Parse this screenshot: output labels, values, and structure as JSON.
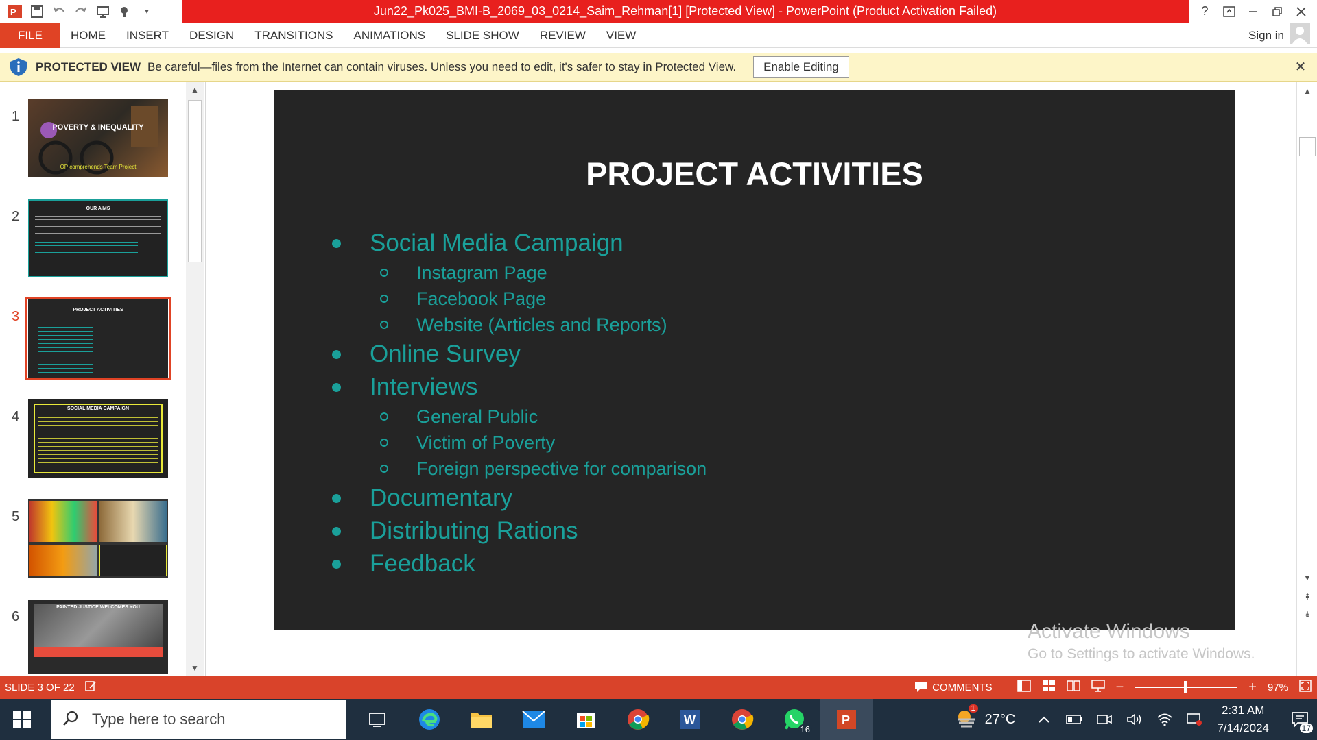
{
  "window": {
    "title": "Jun22_Pk025_BMI-B_2069_03_0214_Saim_Rehman[1] [Protected View] -  PowerPoint (Product Activation Failed)",
    "help": "?"
  },
  "ribbon": {
    "file": "FILE",
    "tabs": [
      "HOME",
      "INSERT",
      "DESIGN",
      "TRANSITIONS",
      "ANIMATIONS",
      "SLIDE SHOW",
      "REVIEW",
      "VIEW"
    ],
    "sign_in": "Sign in"
  },
  "protected_view": {
    "title": "PROTECTED VIEW",
    "message": "Be careful—files from the Internet can contain viruses. Unless you need to edit, it's safer to stay in Protected View.",
    "button": "Enable Editing"
  },
  "thumbnails": [
    {
      "num": "1",
      "title": "POVERTY & INEQUALITY",
      "subtitle": "OP comprehends Team Project"
    },
    {
      "num": "2",
      "title": "OUR AIMS"
    },
    {
      "num": "3",
      "title": "PROJECT ACTIVITIES"
    },
    {
      "num": "4",
      "title": "SOCIAL MEDIA CAMPAIGN"
    },
    {
      "num": "5"
    },
    {
      "num": "6",
      "title": "PAINTED JUSTICE WELCOMES YOU"
    }
  ],
  "slide": {
    "title": "PROJECT ACTIVITIES",
    "items": [
      {
        "text": "Social Media Campaign",
        "subs": [
          "Instagram Page",
          "Facebook Page",
          "Website (Articles and Reports)"
        ]
      },
      {
        "text": "Online Survey",
        "subs": []
      },
      {
        "text": "Interviews",
        "subs": [
          "General Public",
          "Victim of Poverty",
          "Foreign perspective for comparison"
        ]
      },
      {
        "text": "Documentary",
        "subs": []
      },
      {
        "text": "Distributing Rations",
        "subs": []
      },
      {
        "text": "Feedback",
        "subs": []
      }
    ],
    "text_color": "#1aa09a",
    "background": "#252525"
  },
  "watermark": {
    "line1": "Activate Windows",
    "line2": "Go to Settings to activate Windows."
  },
  "status": {
    "slide_info": "SLIDE 3 OF 22",
    "comments": "COMMENTS",
    "zoom": "97%",
    "zoom_fraction": 0.48
  },
  "taskbar": {
    "search_placeholder": "Type here to search",
    "whatsapp_badge": "16",
    "weather": "27°C",
    "weather_badge": "1",
    "time": "2:31 AM",
    "date": "7/14/2024",
    "notif_badge": "17"
  },
  "colors": {
    "title_bar": "#e8201e",
    "accent": "#e04325",
    "status_bar": "#d9432a",
    "protected_bar": "#fdf5c8",
    "taskbar": "#1f2f3f"
  }
}
